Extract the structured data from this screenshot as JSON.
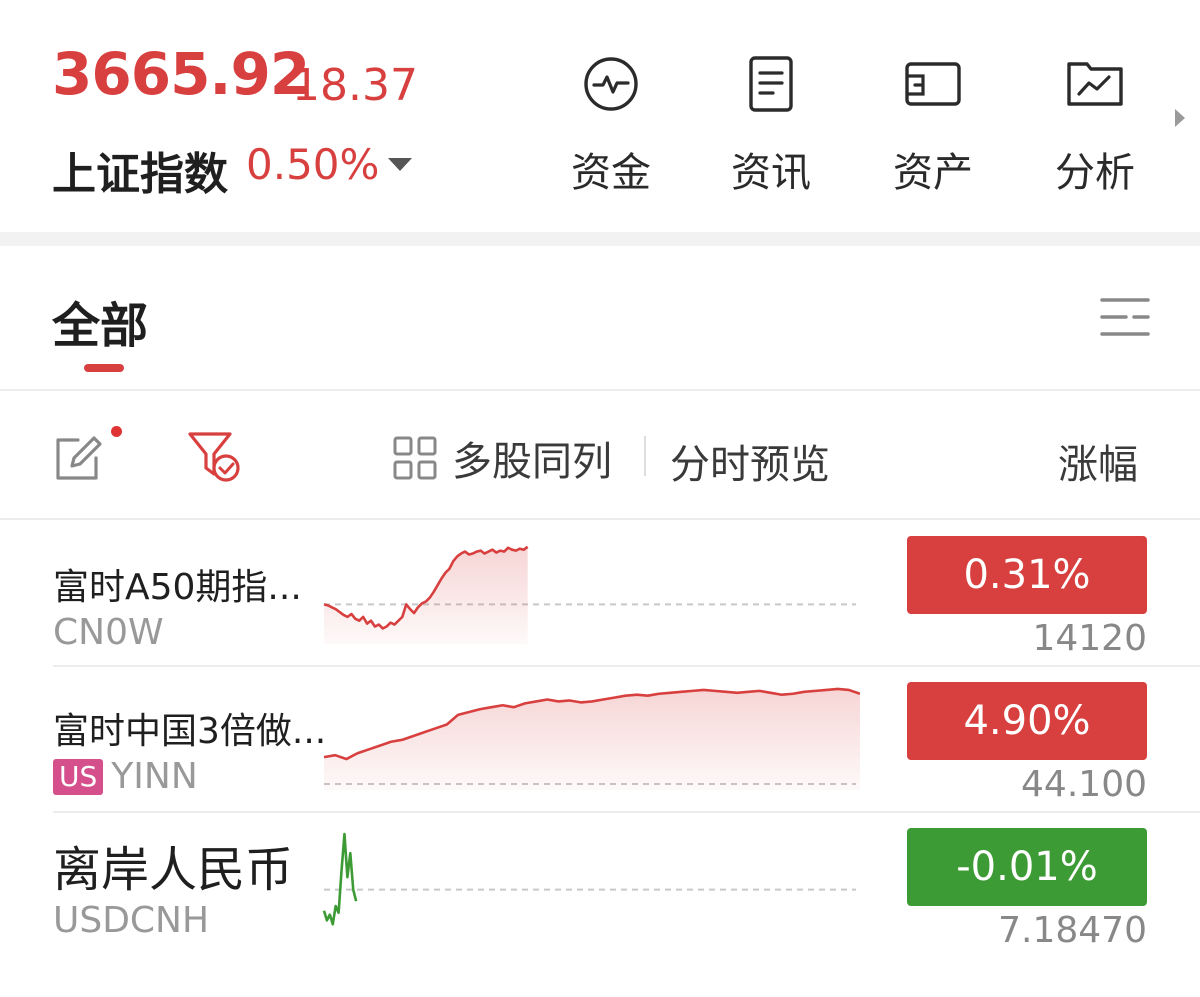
{
  "header": {
    "price": "3665.92",
    "change": "18.37",
    "index_name": "上证指数",
    "change_pct": "0.50%",
    "tools": [
      {
        "label": "资金",
        "icon": "pulse-circle-icon"
      },
      {
        "label": "资讯",
        "icon": "document-icon"
      },
      {
        "label": "资产",
        "icon": "wallet-icon"
      },
      {
        "label": "分析",
        "icon": "chart-folder-icon"
      }
    ]
  },
  "tabs": {
    "active": "全部"
  },
  "toolbar": {
    "multi_label": "多股同列",
    "preview_label": "分时预览",
    "sort_label": "涨幅"
  },
  "colors": {
    "up": "#d8403f",
    "down": "#3d9b35",
    "us_badge": "#d44f8b"
  },
  "rows": [
    {
      "name": "富时A50期指...",
      "code": "CN0W",
      "badge": "",
      "pct": "0.31%",
      "last": "14120",
      "direction": "up",
      "spark": [
        0.35,
        0.34,
        0.32,
        0.3,
        0.27,
        0.24,
        0.22,
        0.25,
        0.2,
        0.18,
        0.22,
        0.15,
        0.18,
        0.12,
        0.14,
        0.1,
        0.12,
        0.16,
        0.14,
        0.18,
        0.22,
        0.35,
        0.3,
        0.26,
        0.32,
        0.36,
        0.38,
        0.42,
        0.48,
        0.55,
        0.62,
        0.68,
        0.72,
        0.8,
        0.85,
        0.88,
        0.9,
        0.87,
        0.88,
        0.9,
        0.91,
        0.88,
        0.9,
        0.92,
        0.89,
        0.91,
        0.9,
        0.94,
        0.92,
        0.91,
        0.93,
        0.92,
        0.95
      ],
      "spark_span": 0.38,
      "baseline": 0.35
    },
    {
      "name": "富时中国3倍做...",
      "code": "YINN",
      "badge": "US",
      "pct": "4.90%",
      "last": "44.100",
      "direction": "up",
      "spark": [
        0.28,
        0.3,
        0.26,
        0.32,
        0.36,
        0.4,
        0.44,
        0.46,
        0.5,
        0.54,
        0.58,
        0.62,
        0.72,
        0.75,
        0.78,
        0.8,
        0.82,
        0.8,
        0.84,
        0.86,
        0.88,
        0.86,
        0.87,
        0.85,
        0.86,
        0.88,
        0.9,
        0.92,
        0.93,
        0.92,
        0.94,
        0.95,
        0.96,
        0.97,
        0.98,
        0.97,
        0.96,
        0.95,
        0.96,
        0.97,
        0.95,
        0.93,
        0.94,
        0.96,
        0.97,
        0.98,
        0.99,
        0.98,
        0.94
      ],
      "spark_span": 1.0,
      "baseline": 0.0
    },
    {
      "name": "离岸人民币",
      "code": "USDCNH",
      "badge": "",
      "pct": "-0.01%",
      "last": "7.18470",
      "direction": "down",
      "spark": [
        0.2,
        0.1,
        0.16,
        0.06,
        0.25,
        0.18,
        0.62,
        1.0,
        0.55,
        0.8,
        0.42,
        0.3
      ],
      "spark_span": 0.06,
      "baseline": 0.42
    }
  ]
}
